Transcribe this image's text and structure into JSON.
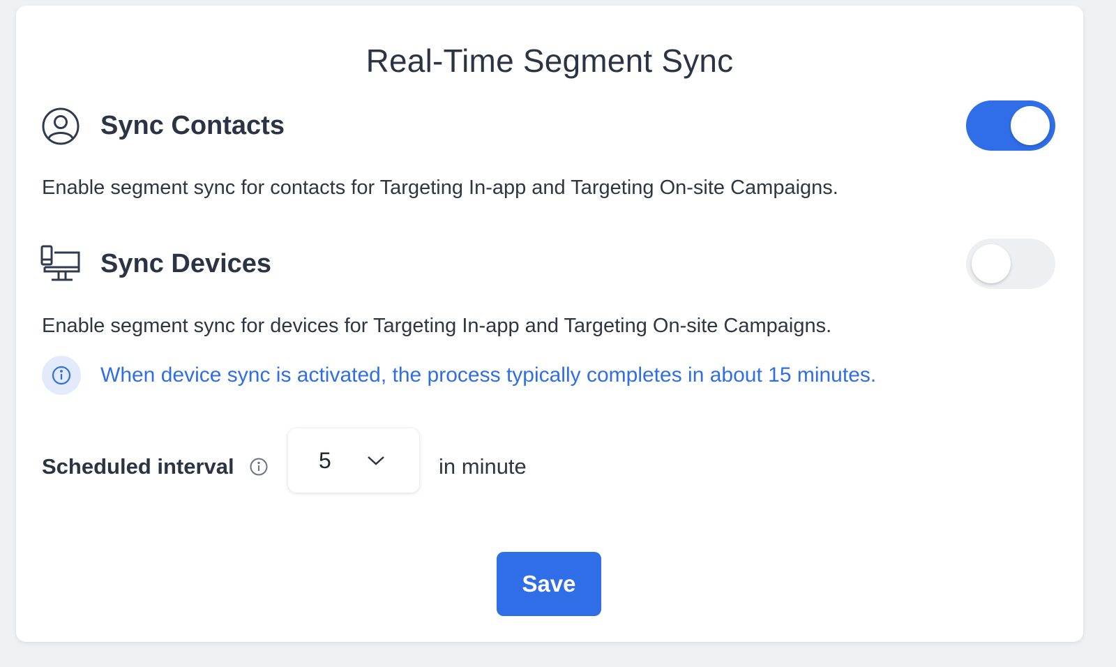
{
  "card": {
    "title": "Real-Time Segment Sync"
  },
  "contacts": {
    "icon": "user-circle-icon",
    "title": "Sync Contacts",
    "description": "Enable segment sync for contacts for Targeting In-app and Targeting On-site Campaigns.",
    "toggle_on": true
  },
  "devices": {
    "icon": "devices-icon",
    "title": "Sync Devices",
    "description": "Enable segment sync for devices for Targeting In-app and Targeting On-site Campaigns.",
    "toggle_on": false,
    "info_icon": "info-icon",
    "info_text": "When device sync is activated, the process typically completes in about 15 minutes."
  },
  "interval": {
    "label": "Scheduled interval",
    "info_icon": "info-icon",
    "value": "5",
    "chevron_icon": "chevron-down-icon",
    "unit": "in minute"
  },
  "actions": {
    "save_label": "Save"
  },
  "colors": {
    "accent": "#2f6ee6",
    "toggle_off": "#eeeff2",
    "text_dark": "#2b3443",
    "info_bg": "#e3eafb"
  }
}
